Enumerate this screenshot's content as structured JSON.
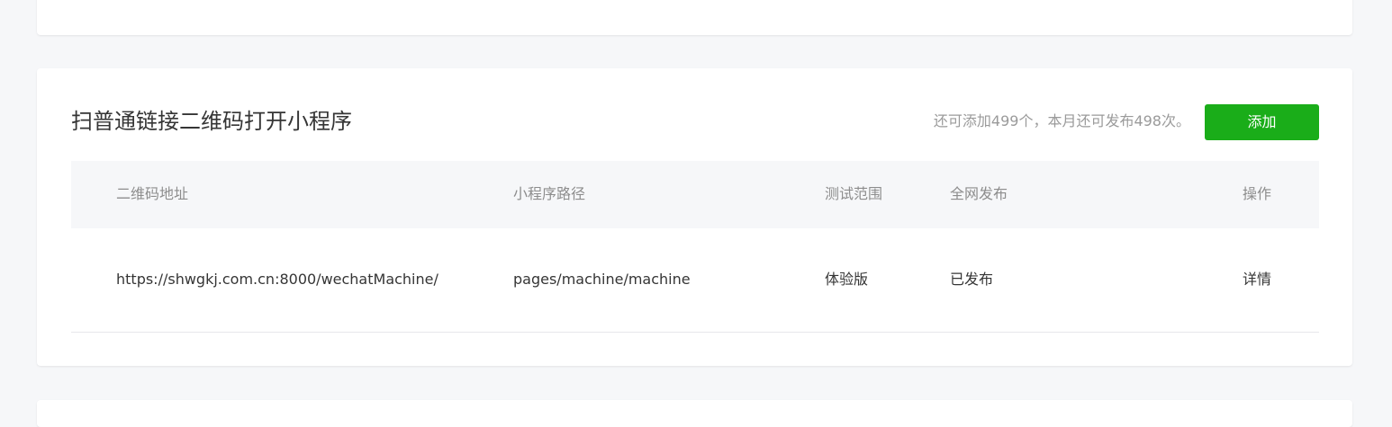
{
  "section": {
    "title": "扫普通链接二维码打开小程序",
    "quota_text": "还可添加499个，本月还可发布498次。",
    "add_button_label": "添加"
  },
  "table": {
    "headers": {
      "qr_address": "二维码地址",
      "mini_path": "小程序路径",
      "test_scope": "测试范围",
      "global_publish": "全网发布",
      "actions": "操作"
    },
    "rows": [
      {
        "qr_address": "https://shwgkj.com.cn:8000/wechatMachine/",
        "mini_path": "pages/machine/machine",
        "test_scope": "体验版",
        "global_publish": "已发布",
        "action_label": "详情"
      }
    ]
  },
  "colors": {
    "accent_green": "#1aad19",
    "link_blue": "#576b95",
    "page_background": "#f6f7f9"
  }
}
